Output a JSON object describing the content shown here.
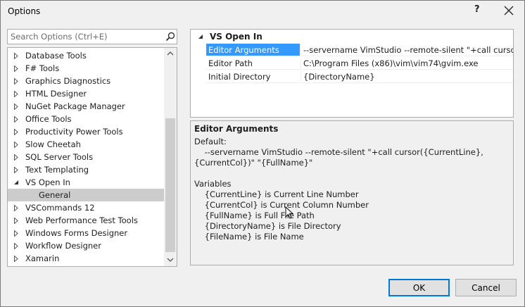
{
  "window": {
    "title": "Options",
    "help_glyph": "?",
    "close_label": "Close"
  },
  "search": {
    "placeholder": "Search Options (Ctrl+E)"
  },
  "tree": {
    "items": [
      {
        "label": "Database Tools",
        "expanded": false
      },
      {
        "label": "F# Tools",
        "expanded": false
      },
      {
        "label": "Graphics Diagnostics",
        "expanded": false
      },
      {
        "label": "HTML Designer",
        "expanded": false
      },
      {
        "label": "NuGet Package Manager",
        "expanded": false
      },
      {
        "label": "Office Tools",
        "expanded": false
      },
      {
        "label": "Productivity Power Tools",
        "expanded": false
      },
      {
        "label": "Slow Cheetah",
        "expanded": false
      },
      {
        "label": "SQL Server Tools",
        "expanded": false
      },
      {
        "label": "Text Templating",
        "expanded": false
      },
      {
        "label": "VS Open In",
        "expanded": true
      },
      {
        "label": "General",
        "child": true,
        "selected": true
      },
      {
        "label": "VSCommands 12",
        "expanded": false
      },
      {
        "label": "Web Performance Test Tools",
        "expanded": false
      },
      {
        "label": "Windows Forms Designer",
        "expanded": false
      },
      {
        "label": "Workflow Designer",
        "expanded": false
      },
      {
        "label": "Xamarin",
        "expanded": false
      }
    ]
  },
  "property_grid": {
    "category": "VS Open In",
    "rows": [
      {
        "name": "Editor Arguments",
        "value": "--servername VimStudio --remote-silent \"+call cursor({C",
        "selected": true
      },
      {
        "name": "Editor Path",
        "value": "C:\\Program Files (x86)\\vim\\vim74\\gvim.exe",
        "selected": false
      },
      {
        "name": "Initial Directory",
        "value": "{DirectoryName}",
        "selected": false
      }
    ]
  },
  "description": {
    "title": "Editor Arguments",
    "lines": [
      "Default:",
      "    --servername VimStudio --remote-silent \"+call cursor({CurrentLine},",
      "{CurrentCol})\" \"{FullName}\"",
      "",
      "Variables",
      "    {CurrentLine} is Current Line Number",
      "    {CurrentCol} is Current Column Number",
      "    {FullName} is Full File Path",
      "    {DirectoryName} is File Directory",
      "    {FileName} is File Name"
    ]
  },
  "buttons": {
    "ok": "OK",
    "cancel": "Cancel"
  },
  "colors": {
    "selection": "#3399ff",
    "tree_selection": "#cccccc",
    "ok_border": "#0078d7"
  }
}
